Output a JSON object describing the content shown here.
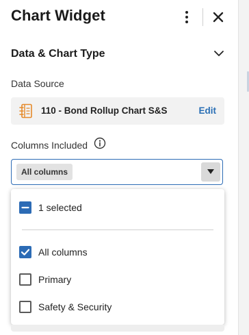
{
  "header": {
    "title": "Chart Widget"
  },
  "section": {
    "title": "Data & Chart Type"
  },
  "data_source": {
    "label": "Data Source",
    "name": "110 - Bond Rollup Chart S&S",
    "edit_label": "Edit"
  },
  "columns": {
    "label": "Columns Included",
    "selected_chip": "All columns",
    "dropdown": {
      "summary": "1 selected",
      "options": [
        {
          "label": "All columns",
          "checked": true
        },
        {
          "label": "Primary",
          "checked": false
        },
        {
          "label": "Safety & Security",
          "checked": false
        }
      ]
    }
  },
  "colors": {
    "accent": "#2c6bb5",
    "link": "#2a6fb5",
    "source_icon": "#e58a2b"
  },
  "icons": {
    "menu": "kebab-menu-icon",
    "close": "close-icon",
    "chevron": "chevron-down-icon",
    "source": "notebook-icon",
    "info": "info-icon",
    "dropdown_arrow": "caret-down-icon"
  }
}
